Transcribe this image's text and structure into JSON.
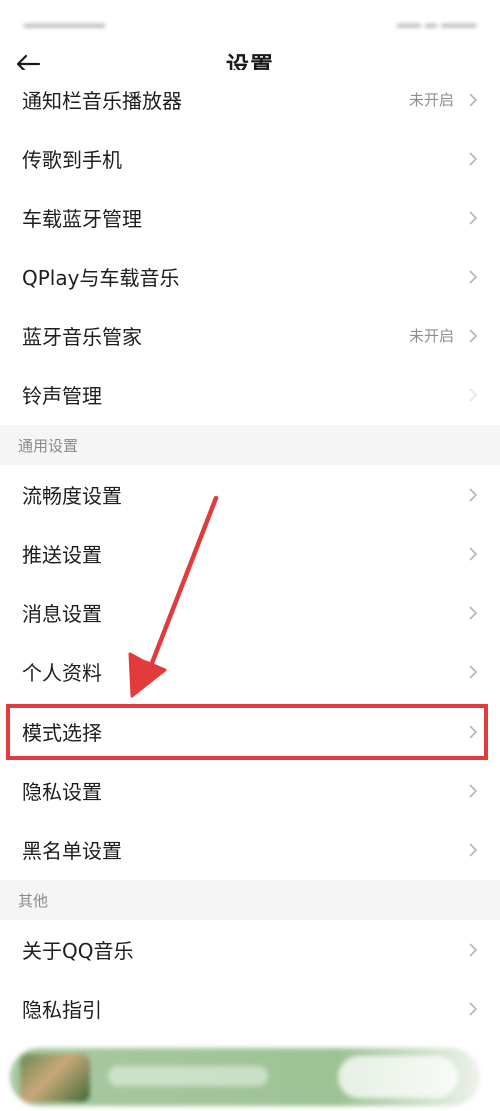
{
  "header": {
    "title": "设置"
  },
  "section_1": {
    "items": [
      {
        "label": "通知栏音乐播放器",
        "value": "未开启"
      },
      {
        "label": "传歌到手机",
        "value": ""
      },
      {
        "label": "车载蓝牙管理",
        "value": ""
      },
      {
        "label": "QPlay与车载音乐",
        "value": ""
      },
      {
        "label": "蓝牙音乐管家",
        "value": "未开启"
      },
      {
        "label": "铃声管理",
        "value": ""
      }
    ]
  },
  "section_general": {
    "title": "通用设置",
    "items": [
      {
        "label": "流畅度设置"
      },
      {
        "label": "推送设置"
      },
      {
        "label": "消息设置"
      },
      {
        "label": "个人资料"
      },
      {
        "label": "模式选择"
      },
      {
        "label": "隐私设置"
      },
      {
        "label": "黑名单设置"
      }
    ]
  },
  "section_other": {
    "title": "其他",
    "items": [
      {
        "label": "关于QQ音乐"
      },
      {
        "label": "隐私指引"
      }
    ]
  },
  "colors": {
    "highlight": "#e23b3b",
    "section_bg": "#f5f5f5",
    "secondary_text": "#8f8f8f"
  }
}
